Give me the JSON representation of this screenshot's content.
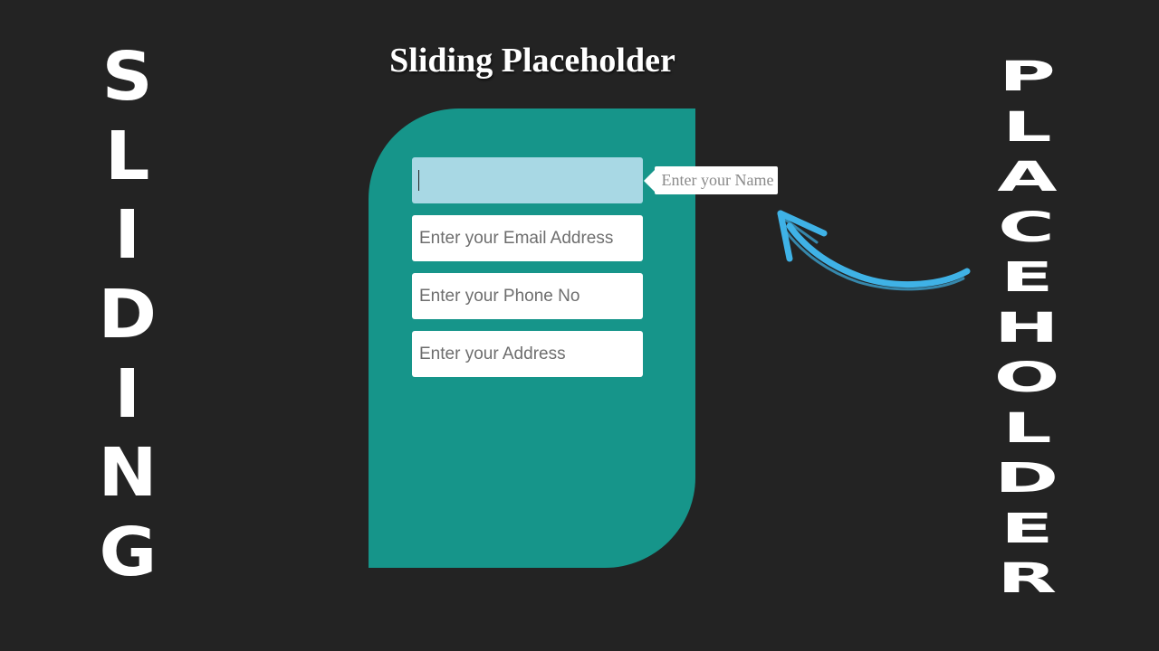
{
  "title": "Sliding Placeholder",
  "side_text": {
    "left_letters": [
      "S",
      "L",
      "I",
      "D",
      "I",
      "N",
      "G"
    ],
    "right_letters": [
      "P",
      "L",
      "A",
      "C",
      "E",
      "H",
      "O",
      "L",
      "D",
      "E",
      "R"
    ]
  },
  "form": {
    "fields": [
      {
        "value": "",
        "placeholder": ""
      },
      {
        "value": "",
        "placeholder": "Enter your Email Address"
      },
      {
        "value": "",
        "placeholder": "Enter your Phone No"
      },
      {
        "value": "",
        "placeholder": "Enter your Address"
      }
    ],
    "slid_placeholder": "Enter your Name"
  },
  "icons": {
    "arrow": "curved-arrow-icon"
  },
  "colors": {
    "background": "#232323",
    "card": "#16958a",
    "focused_field": "#a8d8e4",
    "arrow": "#3fb2e6",
    "text": "#ffffff"
  }
}
